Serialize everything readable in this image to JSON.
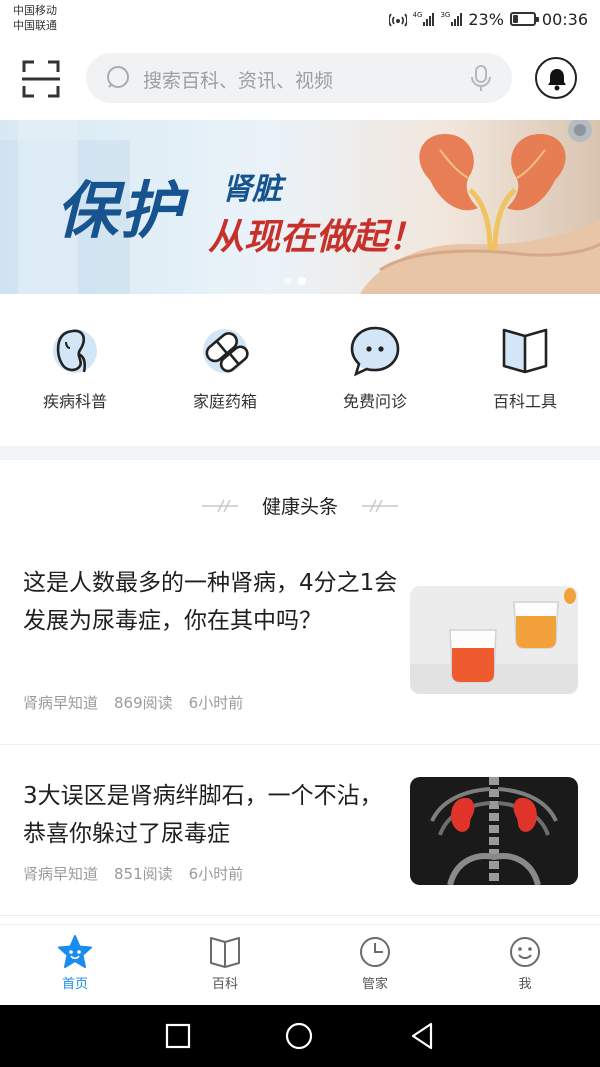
{
  "status_bar": {
    "carrier_1": "中国移动",
    "carrier_2": "中国联通",
    "network_1": "4G",
    "network_2": "3G",
    "battery": "23%",
    "battery_level": 0.23,
    "time": "00:36"
  },
  "header": {
    "search_placeholder": "搜索百科、资讯、视频"
  },
  "banner": {
    "title_big": "保护",
    "title_small": "肾脏",
    "subtitle": "从现在做起！",
    "active_slide": 2,
    "slide_count": 2
  },
  "quick_entries": [
    {
      "label": "疾病科普",
      "icon": "kidney-icon"
    },
    {
      "label": "家庭药箱",
      "icon": "pill-icon"
    },
    {
      "label": "免费问诊",
      "icon": "chat-bubble-icon"
    },
    {
      "label": "百科工具",
      "icon": "book-icon"
    }
  ],
  "section": {
    "title": "健康头条"
  },
  "articles": [
    {
      "title": "这是人数最多的一种肾病，4分之1会发展为尿毒症，你在其中吗？",
      "source": "肾病早知道",
      "reads": "869阅读",
      "time": "6小时前"
    },
    {
      "title": "3大误区是肾病绊脚石，一个不沾，恭喜你躲过了尿毒症",
      "source": "肾病早知道",
      "reads": "851阅读",
      "time": "6小时前"
    }
  ],
  "bottom_nav": [
    {
      "label": "首页",
      "icon": "star-face-icon",
      "active": true
    },
    {
      "label": "百科",
      "icon": "book-icon",
      "active": false
    },
    {
      "label": "管家",
      "icon": "clock-icon",
      "active": false
    },
    {
      "label": "我",
      "icon": "smiley-icon",
      "active": false
    }
  ],
  "colors": {
    "accent": "#1a8cf0",
    "banner_blue": "#17548f",
    "banner_red": "#c8302a"
  }
}
